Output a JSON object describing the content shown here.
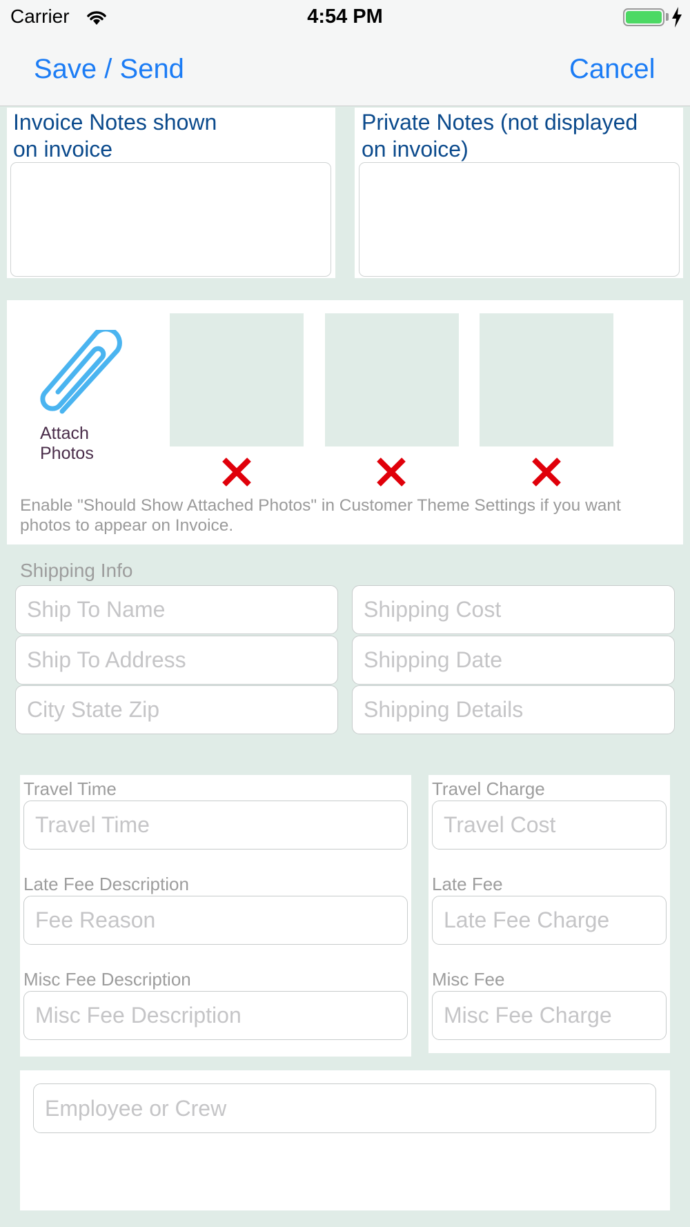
{
  "status_bar": {
    "carrier": "Carrier",
    "time": "4:54 PM"
  },
  "nav": {
    "save_label": "Save / Send",
    "cancel_label": "Cancel"
  },
  "notes": {
    "invoice_notes_label": "Invoice Notes shown\non invoice",
    "invoice_notes_value": "",
    "private_notes_label": "Private Notes (not displayed\non invoice)",
    "private_notes_value": ""
  },
  "photos": {
    "attach_label": "Attach\nPhotos",
    "hint": "Enable \"Should Show Attached Photos\" in Customer Theme Settings if you want photos to appear on Invoice."
  },
  "shipping": {
    "title": "Shipping Info",
    "ship_to_name_placeholder": "Ship To Name",
    "shipping_cost_placeholder": "Shipping Cost",
    "ship_to_address_placeholder": "Ship To Address",
    "shipping_date_placeholder": "Shipping Date",
    "city_state_zip_placeholder": "City State Zip",
    "shipping_details_placeholder": "Shipping Details"
  },
  "fees": {
    "travel_time_label": "Travel Time",
    "travel_time_placeholder": "Travel Time",
    "travel_charge_label": "Travel Charge",
    "travel_charge_placeholder": "Travel Cost",
    "late_fee_desc_label": "Late Fee Description",
    "late_fee_desc_placeholder": "Fee Reason",
    "late_fee_label": "Late Fee",
    "late_fee_placeholder": "Late Fee Charge",
    "misc_fee_desc_label": "Misc Fee Description",
    "misc_fee_desc_placeholder": "Misc Fee Description",
    "misc_fee_label": "Misc Fee",
    "misc_fee_placeholder": "Misc Fee Charge"
  },
  "crew": {
    "placeholder": "Employee or Crew"
  },
  "colors": {
    "accent": "#1b7cf5",
    "notes_label": "#0b4a8c",
    "background": "#e0ece7",
    "delete_x": "#e0000a",
    "paperclip": "#4ab4f0"
  }
}
